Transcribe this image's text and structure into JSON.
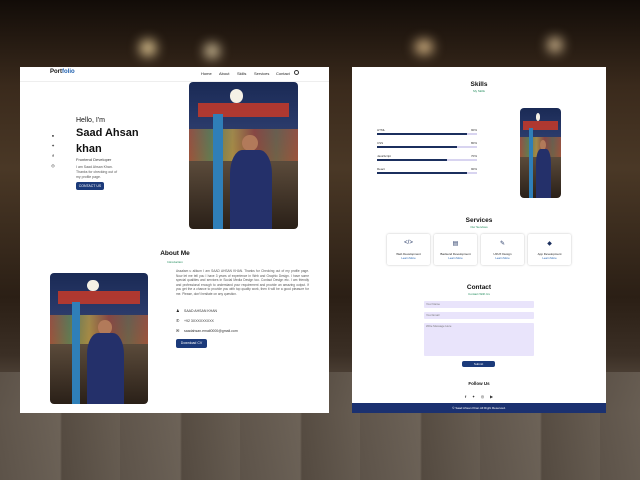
{
  "nav": {
    "logo_prefix": "Port",
    "logo_suffix": "folio",
    "links": [
      "Home",
      "About",
      "Skills",
      "Services",
      "Contact"
    ]
  },
  "hero": {
    "greeting": "Hello, I'm",
    "name": "Saad Ahsan khan",
    "role": "Frontend Developer",
    "intro": "I am Saad Ahsan Khan. Thanks for checking out of my profile page.",
    "button": "CONTACT US",
    "social_icons": [
      "github-icon",
      "twitter-icon",
      "facebook-icon",
      "instagram-icon"
    ]
  },
  "about": {
    "title": "About Me",
    "subtitle": "Introduction",
    "paragraph": "Assalam u alikum I am SAAD AHSAN KHAN. Thanks for Checking out of my profile page. Now let me tell you I have 3 years of experience in Web and Graphic Design. I have some special qualities and services in Social Media Design too. Contact Design etc. I am friendly and professional enough to understand your requirement and provide an amazing output. If you get the a chance to provide you with top quality work, then it will be a good pleasure for me. Please, don't hesitate on any question.",
    "name_row": "SAAD AHSAN KHAN",
    "phone_row": "+92 3XXXXXXXXX",
    "email_row": "saadahsan.email0000@gmail.com",
    "button": "Download CV"
  },
  "skills": {
    "title": "Skills",
    "subtitle": "My Skills",
    "items": [
      {
        "name": "HTML",
        "percent": "90%",
        "value": 0.9
      },
      {
        "name": "CSS",
        "percent": "80%",
        "value": 0.8
      },
      {
        "name": "JavaScript",
        "percent": "70%",
        "value": 0.7
      },
      {
        "name": "React",
        "percent": "90%",
        "value": 0.9
      }
    ]
  },
  "services": {
    "title": "Services",
    "subtitle": "Our Services",
    "items": [
      {
        "title": "Web Development",
        "link": "Learn More",
        "icon": "code-icon"
      },
      {
        "title": "Backend Development",
        "link": "Learn More",
        "icon": "server-icon"
      },
      {
        "title": "UI/UX Design",
        "link": "Learn More",
        "icon": "pen-tool-icon"
      },
      {
        "title": "App Development",
        "link": "Learn More",
        "icon": "android-icon"
      }
    ]
  },
  "contact": {
    "title": "Contact",
    "subtitle": "Contact With Us",
    "name_placeholder": "Your Name",
    "email_placeholder": "Your Email",
    "message_placeholder": "Write Message Here",
    "submit": "Submit"
  },
  "follow": {
    "title": "Follow Us",
    "icons": [
      "facebook-icon",
      "twitter-icon",
      "instagram-icon",
      "youtube-icon"
    ]
  },
  "footer": {
    "text": "© Saad Ahsan Khan All Right Reserved."
  },
  "colors": {
    "accent": "#1b3a7a",
    "skill_bar": "#1b2f5e",
    "field_bg": "#e9e4fb",
    "footer_bg": "#1b3170"
  }
}
